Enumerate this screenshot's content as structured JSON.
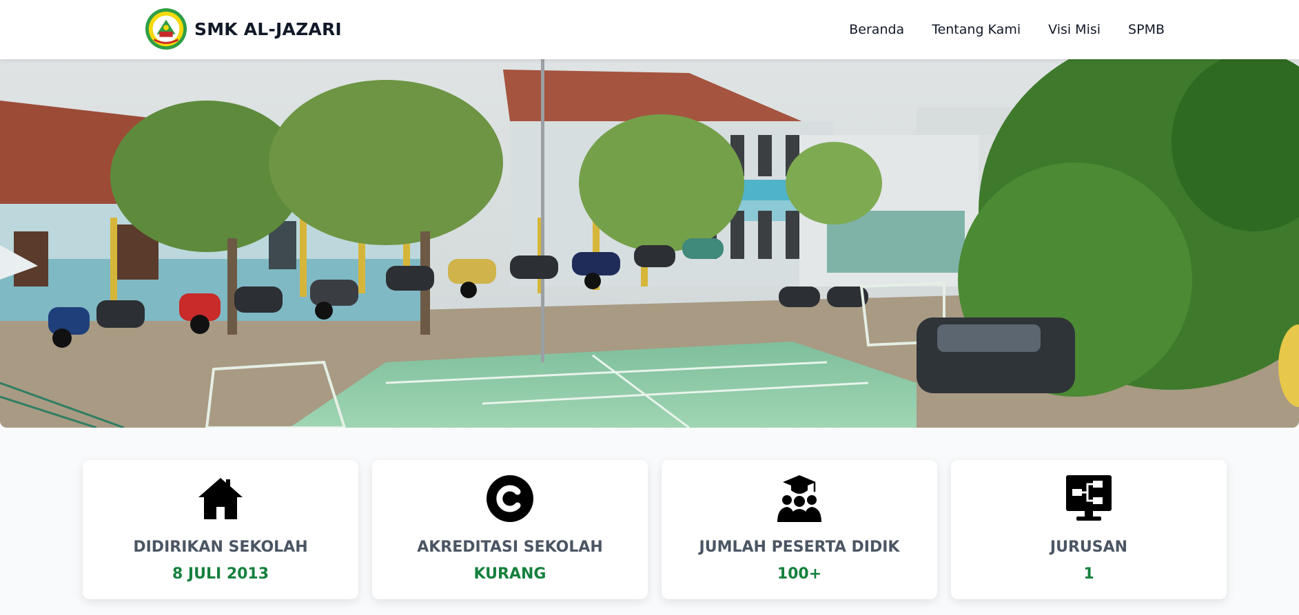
{
  "brand": {
    "name": "SMK AL-JAZARI",
    "logo_icon": "school-emblem-logo"
  },
  "nav": {
    "items": [
      "Beranda",
      "Tentang Kami",
      "Visi Misi",
      "SPMB"
    ]
  },
  "hero": {
    "image": "school-campus-photo"
  },
  "stats": [
    {
      "icon": "house-icon",
      "title": "DIDIRIKAN SEKOLAH",
      "value": "8 JULI 2013"
    },
    {
      "icon": "copyright-c-icon",
      "title": "AKREDITASI SEKOLAH",
      "value": "KURANG"
    },
    {
      "icon": "graduation-group-icon",
      "title": "JUMLAH PESERTA DIDIK",
      "value": "100+"
    },
    {
      "icon": "network-monitor-icon",
      "title": "JURUSAN",
      "value": "1"
    }
  ],
  "colors": {
    "accent": "#15803d",
    "title": "#4b5563",
    "text": "#111827",
    "logo_green": "#2f9e44",
    "logo_yellow": "#f5d90a"
  }
}
